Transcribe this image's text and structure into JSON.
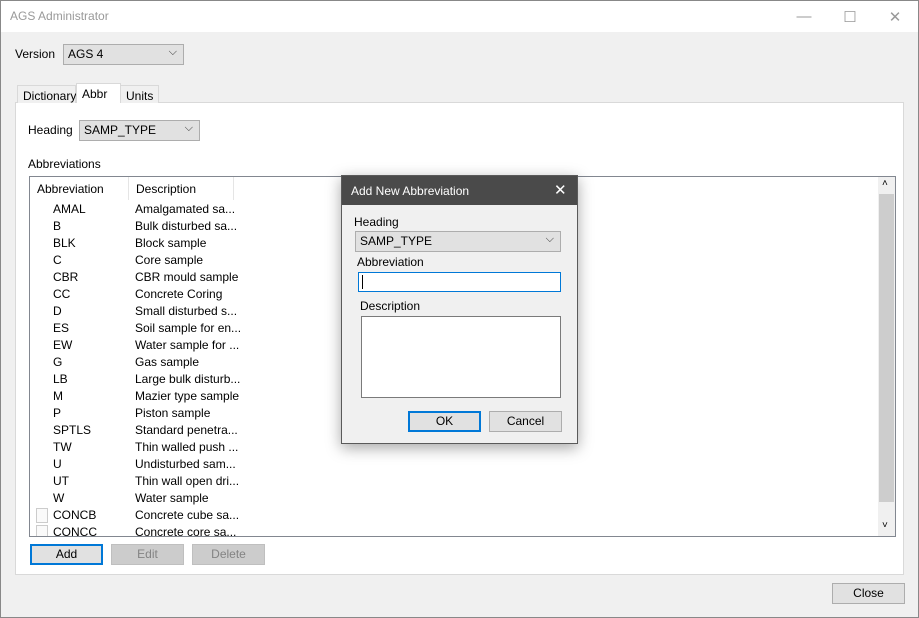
{
  "window": {
    "title": "AGS Administrator",
    "minimize": "—",
    "maximize": "☐",
    "close": "✕"
  },
  "version": {
    "label": "Version",
    "value": "AGS 4"
  },
  "tabs": [
    {
      "label": "Dictionary"
    },
    {
      "label": "Abbr"
    },
    {
      "label": "Units"
    }
  ],
  "abbr": {
    "heading_label": "Heading",
    "heading_value": "SAMP_TYPE",
    "abbreviations_label": "Abbreviations",
    "columns": [
      "Abbreviation",
      "Description"
    ],
    "rows": [
      {
        "abbr": "AMAL",
        "desc": "Amalgamated sa..."
      },
      {
        "abbr": "B",
        "desc": "Bulk disturbed sa..."
      },
      {
        "abbr": "BLK",
        "desc": "Block sample"
      },
      {
        "abbr": "C",
        "desc": "Core sample"
      },
      {
        "abbr": "CBR",
        "desc": "CBR mould sample"
      },
      {
        "abbr": "CC",
        "desc": "Concrete Coring"
      },
      {
        "abbr": "D",
        "desc": "Small disturbed s..."
      },
      {
        "abbr": "ES",
        "desc": "Soil sample for en..."
      },
      {
        "abbr": "EW",
        "desc": "Water sample for ..."
      },
      {
        "abbr": "G",
        "desc": "Gas sample"
      },
      {
        "abbr": "LB",
        "desc": "Large bulk disturb..."
      },
      {
        "abbr": "M",
        "desc": "Mazier type sample"
      },
      {
        "abbr": "P",
        "desc": "Piston sample"
      },
      {
        "abbr": "SPTLS",
        "desc": "Standard penetra..."
      },
      {
        "abbr": "TW",
        "desc": "Thin walled push ..."
      },
      {
        "abbr": "U",
        "desc": "Undisturbed sam..."
      },
      {
        "abbr": "UT",
        "desc": "Thin wall open dri..."
      },
      {
        "abbr": "W",
        "desc": "Water sample"
      },
      {
        "abbr": "CONCB",
        "desc": "Concrete cube sa...",
        "icon": true
      },
      {
        "abbr": "CONCC",
        "desc": "Concrete core sa...",
        "icon": true
      }
    ],
    "add": "Add",
    "edit": "Edit",
    "delete": "Delete"
  },
  "close_button": "Close",
  "dialog": {
    "title": "Add New Abbreviation",
    "close": "✕",
    "heading_label": "Heading",
    "heading_value": "SAMP_TYPE",
    "abbreviation_label": "Abbreviation",
    "abbreviation_value": "",
    "description_label": "Description",
    "description_value": "",
    "ok": "OK",
    "cancel": "Cancel"
  }
}
